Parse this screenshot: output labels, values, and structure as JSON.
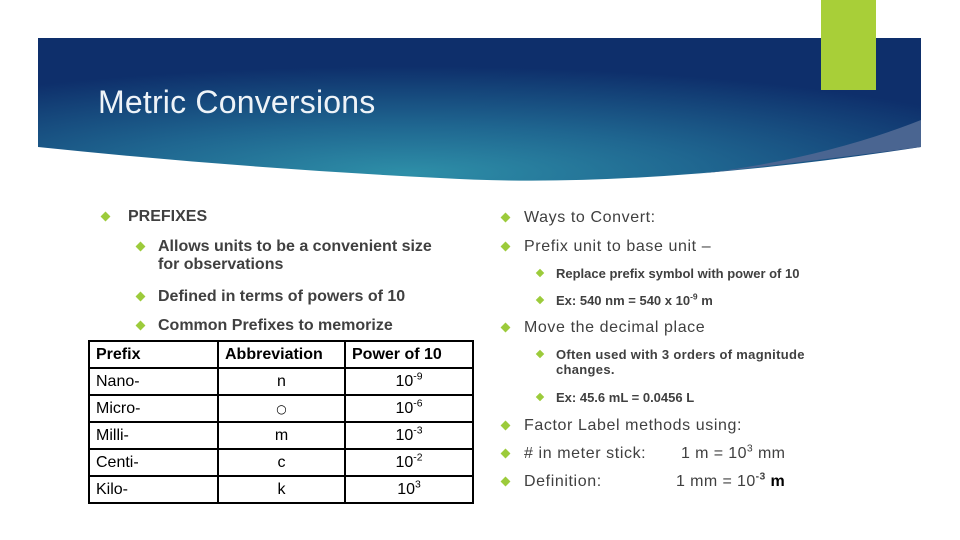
{
  "slide": {
    "title": "Metric Conversions",
    "colors": {
      "accent_green": "#9ccb3b",
      "banner_dark": "#0e2f6b",
      "banner_light": "#2e8ba6",
      "text": "#404040"
    }
  },
  "left": {
    "heading": "PREFIXES",
    "items": [
      {
        "line1": "Allows units to be a convenient size",
        "line2": "for observations"
      },
      {
        "line1": "Defined in terms of powers of 10"
      },
      {
        "line1": "Common Prefixes to memorize"
      }
    ],
    "table": {
      "headers": [
        "Prefix",
        "Abbreviation",
        "Power of 10"
      ],
      "rows": [
        {
          "prefix": "Nano-",
          "abbr": "n",
          "base": "10",
          "exp": "-9"
        },
        {
          "prefix": "Micro-",
          "abbr": "○",
          "base": "10",
          "exp": "-6"
        },
        {
          "prefix": "Milli-",
          "abbr": "m",
          "base": "10",
          "exp": "-3"
        },
        {
          "prefix": "Centi-",
          "abbr": "c",
          "base": "10",
          "exp": "-2"
        },
        {
          "prefix": "Kilo-",
          "abbr": "k",
          "base": "10",
          "exp": "3"
        }
      ]
    }
  },
  "right": {
    "ways": "Ways to Convert:",
    "prefix_to_base": "Prefix unit to base unit –",
    "replace": "Replace prefix symbol with power of 10",
    "ex1": {
      "pre": "Ex: 540 nm = 540 x 10",
      "exp": "-9",
      "post": " m"
    },
    "move": "Move the decimal place",
    "often": {
      "line1": "Often used with 3 orders of magnitude",
      "line2": "changes."
    },
    "ex2": "Ex: 45.6 mL = 0.0456 L",
    "factor": "Factor Label methods using:",
    "meter_stick": {
      "label": "# in meter stick:",
      "pre": "1 m = 10",
      "exp": "3",
      "post": " mm"
    },
    "definition": {
      "label": "Definition:",
      "pre": "1 mm = 10",
      "exp": "-3",
      "post": " m"
    }
  }
}
